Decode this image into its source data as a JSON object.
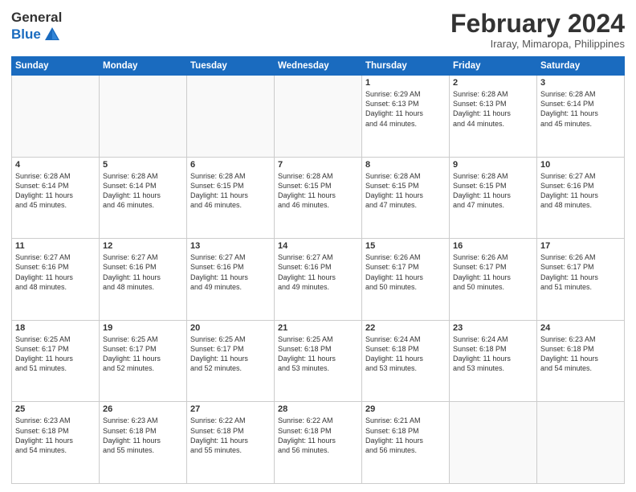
{
  "logo": {
    "line1": "General",
    "line2": "Blue"
  },
  "title": "February 2024",
  "subtitle": "Iraray, Mimaropa, Philippines",
  "weekdays": [
    "Sunday",
    "Monday",
    "Tuesday",
    "Wednesday",
    "Thursday",
    "Friday",
    "Saturday"
  ],
  "weeks": [
    [
      {
        "day": "",
        "info": ""
      },
      {
        "day": "",
        "info": ""
      },
      {
        "day": "",
        "info": ""
      },
      {
        "day": "",
        "info": ""
      },
      {
        "day": "1",
        "info": "Sunrise: 6:29 AM\nSunset: 6:13 PM\nDaylight: 11 hours\nand 44 minutes."
      },
      {
        "day": "2",
        "info": "Sunrise: 6:28 AM\nSunset: 6:13 PM\nDaylight: 11 hours\nand 44 minutes."
      },
      {
        "day": "3",
        "info": "Sunrise: 6:28 AM\nSunset: 6:14 PM\nDaylight: 11 hours\nand 45 minutes."
      }
    ],
    [
      {
        "day": "4",
        "info": "Sunrise: 6:28 AM\nSunset: 6:14 PM\nDaylight: 11 hours\nand 45 minutes."
      },
      {
        "day": "5",
        "info": "Sunrise: 6:28 AM\nSunset: 6:14 PM\nDaylight: 11 hours\nand 46 minutes."
      },
      {
        "day": "6",
        "info": "Sunrise: 6:28 AM\nSunset: 6:15 PM\nDaylight: 11 hours\nand 46 minutes."
      },
      {
        "day": "7",
        "info": "Sunrise: 6:28 AM\nSunset: 6:15 PM\nDaylight: 11 hours\nand 46 minutes."
      },
      {
        "day": "8",
        "info": "Sunrise: 6:28 AM\nSunset: 6:15 PM\nDaylight: 11 hours\nand 47 minutes."
      },
      {
        "day": "9",
        "info": "Sunrise: 6:28 AM\nSunset: 6:15 PM\nDaylight: 11 hours\nand 47 minutes."
      },
      {
        "day": "10",
        "info": "Sunrise: 6:27 AM\nSunset: 6:16 PM\nDaylight: 11 hours\nand 48 minutes."
      }
    ],
    [
      {
        "day": "11",
        "info": "Sunrise: 6:27 AM\nSunset: 6:16 PM\nDaylight: 11 hours\nand 48 minutes."
      },
      {
        "day": "12",
        "info": "Sunrise: 6:27 AM\nSunset: 6:16 PM\nDaylight: 11 hours\nand 48 minutes."
      },
      {
        "day": "13",
        "info": "Sunrise: 6:27 AM\nSunset: 6:16 PM\nDaylight: 11 hours\nand 49 minutes."
      },
      {
        "day": "14",
        "info": "Sunrise: 6:27 AM\nSunset: 6:16 PM\nDaylight: 11 hours\nand 49 minutes."
      },
      {
        "day": "15",
        "info": "Sunrise: 6:26 AM\nSunset: 6:17 PM\nDaylight: 11 hours\nand 50 minutes."
      },
      {
        "day": "16",
        "info": "Sunrise: 6:26 AM\nSunset: 6:17 PM\nDaylight: 11 hours\nand 50 minutes."
      },
      {
        "day": "17",
        "info": "Sunrise: 6:26 AM\nSunset: 6:17 PM\nDaylight: 11 hours\nand 51 minutes."
      }
    ],
    [
      {
        "day": "18",
        "info": "Sunrise: 6:25 AM\nSunset: 6:17 PM\nDaylight: 11 hours\nand 51 minutes."
      },
      {
        "day": "19",
        "info": "Sunrise: 6:25 AM\nSunset: 6:17 PM\nDaylight: 11 hours\nand 52 minutes."
      },
      {
        "day": "20",
        "info": "Sunrise: 6:25 AM\nSunset: 6:17 PM\nDaylight: 11 hours\nand 52 minutes."
      },
      {
        "day": "21",
        "info": "Sunrise: 6:25 AM\nSunset: 6:18 PM\nDaylight: 11 hours\nand 53 minutes."
      },
      {
        "day": "22",
        "info": "Sunrise: 6:24 AM\nSunset: 6:18 PM\nDaylight: 11 hours\nand 53 minutes."
      },
      {
        "day": "23",
        "info": "Sunrise: 6:24 AM\nSunset: 6:18 PM\nDaylight: 11 hours\nand 53 minutes."
      },
      {
        "day": "24",
        "info": "Sunrise: 6:23 AM\nSunset: 6:18 PM\nDaylight: 11 hours\nand 54 minutes."
      }
    ],
    [
      {
        "day": "25",
        "info": "Sunrise: 6:23 AM\nSunset: 6:18 PM\nDaylight: 11 hours\nand 54 minutes."
      },
      {
        "day": "26",
        "info": "Sunrise: 6:23 AM\nSunset: 6:18 PM\nDaylight: 11 hours\nand 55 minutes."
      },
      {
        "day": "27",
        "info": "Sunrise: 6:22 AM\nSunset: 6:18 PM\nDaylight: 11 hours\nand 55 minutes."
      },
      {
        "day": "28",
        "info": "Sunrise: 6:22 AM\nSunset: 6:18 PM\nDaylight: 11 hours\nand 56 minutes."
      },
      {
        "day": "29",
        "info": "Sunrise: 6:21 AM\nSunset: 6:18 PM\nDaylight: 11 hours\nand 56 minutes."
      },
      {
        "day": "",
        "info": ""
      },
      {
        "day": "",
        "info": ""
      }
    ]
  ]
}
